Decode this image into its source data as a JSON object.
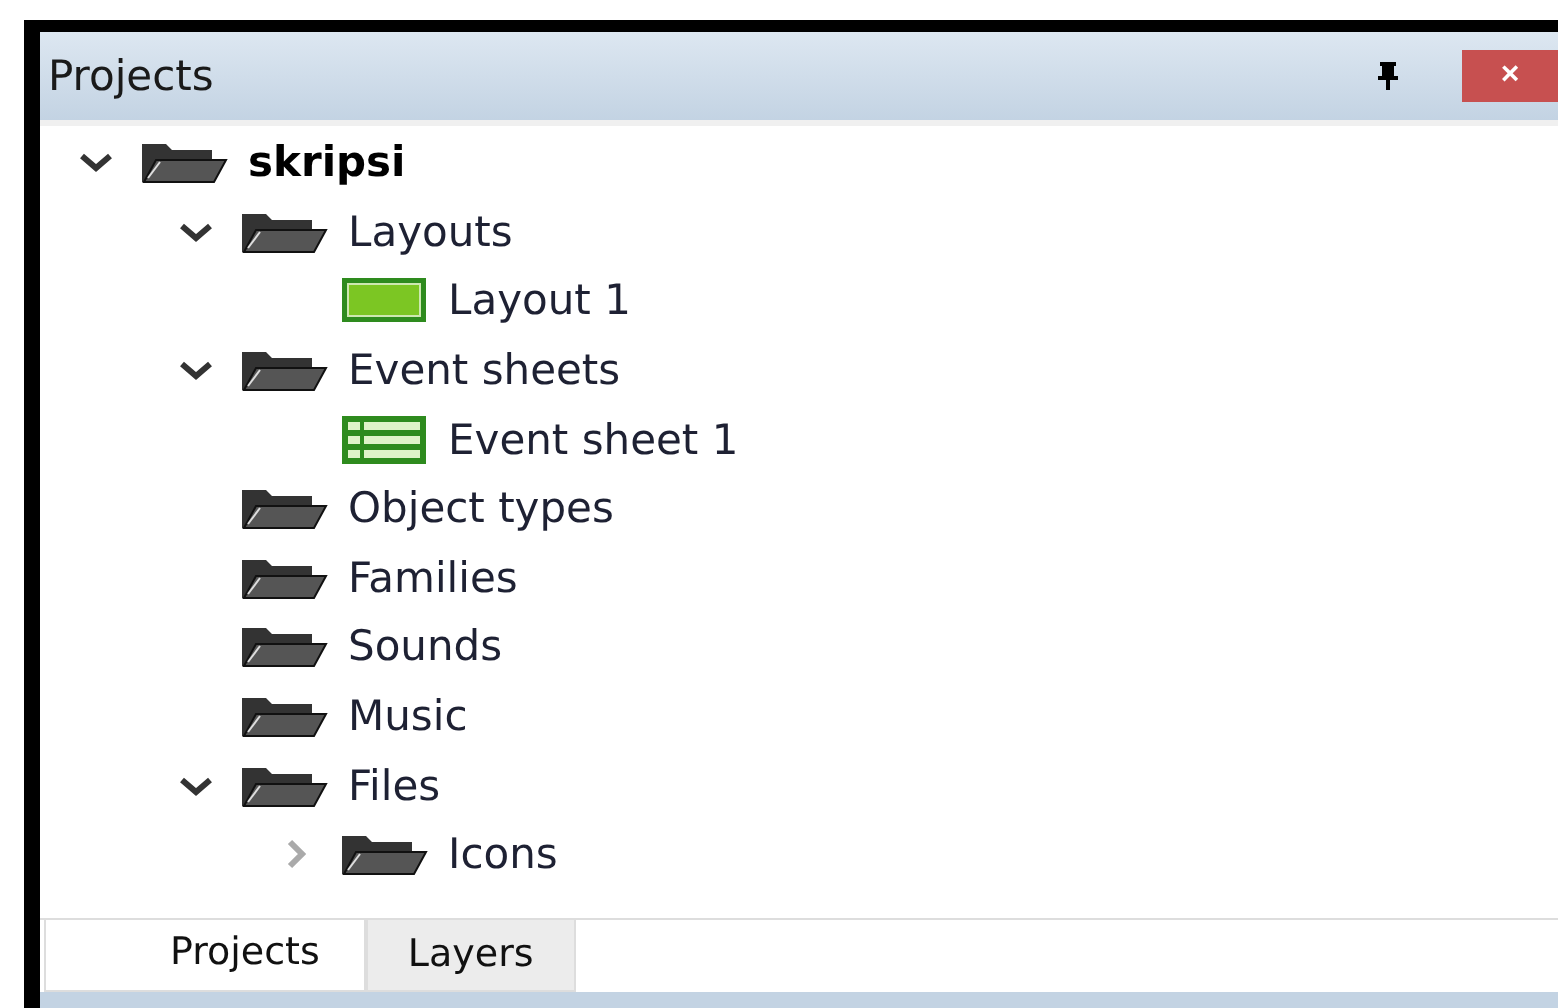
{
  "panel": {
    "title": "Projects",
    "close_label": "×"
  },
  "tree": [
    {
      "label": "skripsi",
      "kind": "folder",
      "expanded": true,
      "children": [
        {
          "label": "Layouts",
          "kind": "folder",
          "expanded": true,
          "children": [
            {
              "label": "Layout 1",
              "kind": "layout"
            }
          ]
        },
        {
          "label": "Event sheets",
          "kind": "folder",
          "expanded": true,
          "children": [
            {
              "label": "Event sheet 1",
              "kind": "eventsheet"
            }
          ]
        },
        {
          "label": "Object types",
          "kind": "folder"
        },
        {
          "label": "Families",
          "kind": "folder"
        },
        {
          "label": "Sounds",
          "kind": "folder"
        },
        {
          "label": "Music",
          "kind": "folder"
        },
        {
          "label": "Files",
          "kind": "folder",
          "expanded": true,
          "children": [
            {
              "label": "Icons",
              "kind": "folder",
              "expanded": false
            }
          ]
        }
      ]
    }
  ],
  "tabs": [
    {
      "label": "Projects",
      "selected": true
    },
    {
      "label": "Layers",
      "selected": false
    }
  ]
}
